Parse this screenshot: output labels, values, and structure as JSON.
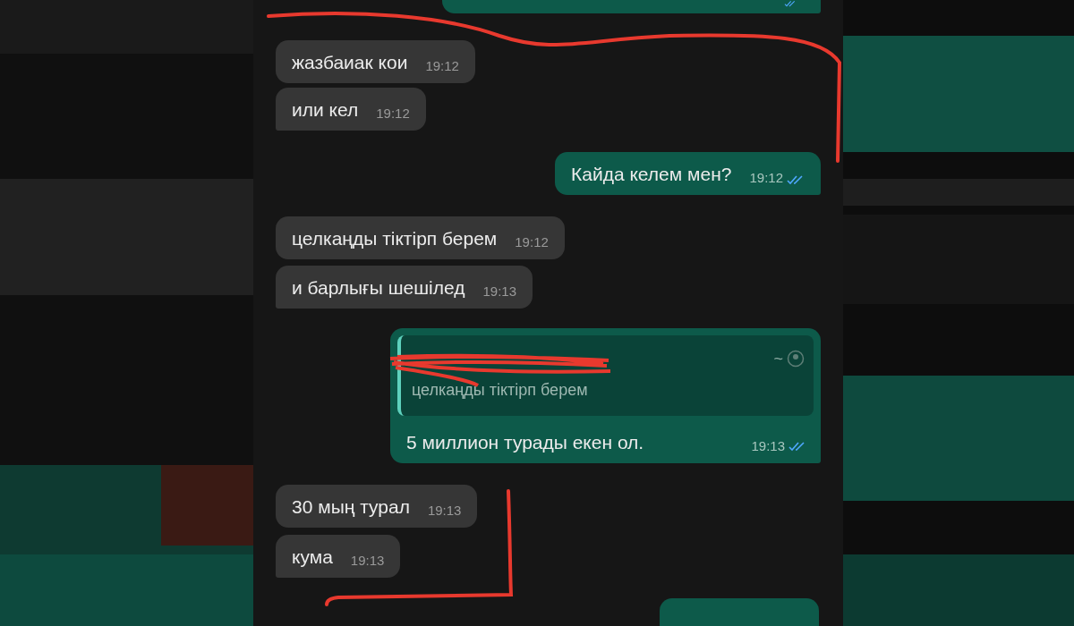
{
  "messages": [
    {
      "kind": "outgoing_cut",
      "read": true
    },
    {
      "kind": "incoming",
      "text": "жазбаиак кои",
      "time": "19:12",
      "tail": false
    },
    {
      "kind": "incoming",
      "text": "или кел",
      "time": "19:12",
      "tail": true
    },
    {
      "kind": "outgoing",
      "text": "Кайда келем мен?",
      "time": "19:12",
      "read": true
    },
    {
      "kind": "incoming",
      "text": "целкаңды тіктірп берем",
      "time": "19:12",
      "tail": false
    },
    {
      "kind": "incoming",
      "text": "и барлығы шешілед",
      "time": "19:13",
      "tail": true
    },
    {
      "kind": "reply",
      "quote": {
        "prefix": "~",
        "text": "целкаңды тіктірп берем"
      },
      "text": "5 миллион турады екен ол.",
      "time": "19:13",
      "read": true
    },
    {
      "kind": "incoming",
      "text": "30 мың турал",
      "time": "19:13",
      "tail": false
    },
    {
      "kind": "incoming",
      "text": "кума",
      "time": "19:13",
      "tail": true
    },
    {
      "kind": "outgoing_cut_bottom"
    }
  ]
}
